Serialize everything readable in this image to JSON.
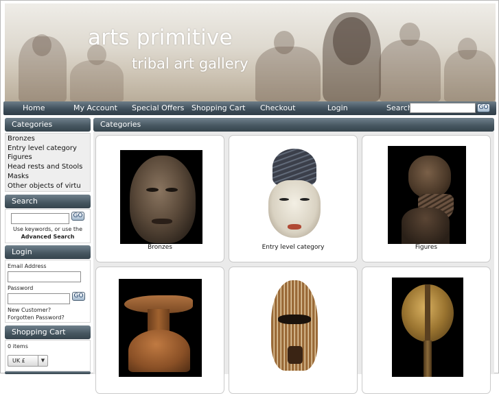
{
  "brand": {
    "title": "arts primitive",
    "tagline": "tribal art gallery"
  },
  "nav": {
    "items": [
      "Home",
      "My Account",
      "Special Offers",
      "Shopping Cart",
      "Checkout",
      "Login"
    ],
    "search_label": "Search",
    "go_label": "GO"
  },
  "sidebar": {
    "categories": {
      "heading": "Categories",
      "items": [
        "Bronzes",
        "Entry level category",
        "Figures",
        "Head rests and Stools",
        "Masks",
        "Other objects of virtu"
      ]
    },
    "search": {
      "heading": "Search",
      "go_label": "GO",
      "hint": "Use keywords, or use the",
      "advanced": "Advanced Search"
    },
    "login": {
      "heading": "Login",
      "email_label": "Email Address",
      "password_label": "Password",
      "go_label": "GO",
      "new_customer": "New Customer?",
      "forgotten": "Forgotten Password?"
    },
    "cart": {
      "heading": "Shopping Cart",
      "items_text": "0 items",
      "currency": "UK £"
    }
  },
  "main": {
    "heading": "Categories",
    "cards": [
      {
        "caption": "Bronzes",
        "image_name": "bronze-head-image"
      },
      {
        "caption": "Entry level category",
        "image_name": "white-mask-image"
      },
      {
        "caption": "Figures",
        "image_name": "figure-image"
      },
      {
        "caption": "",
        "image_name": "headrest-stool-image"
      },
      {
        "caption": "",
        "image_name": "striped-mask-image"
      },
      {
        "caption": "",
        "image_name": "reliquary-figure-image"
      }
    ]
  },
  "colors": {
    "bar_top": "#6f808c",
    "bar_bottom": "#36444d",
    "panel_bg": "#eaeaea",
    "go_text": "#1c3d66"
  }
}
